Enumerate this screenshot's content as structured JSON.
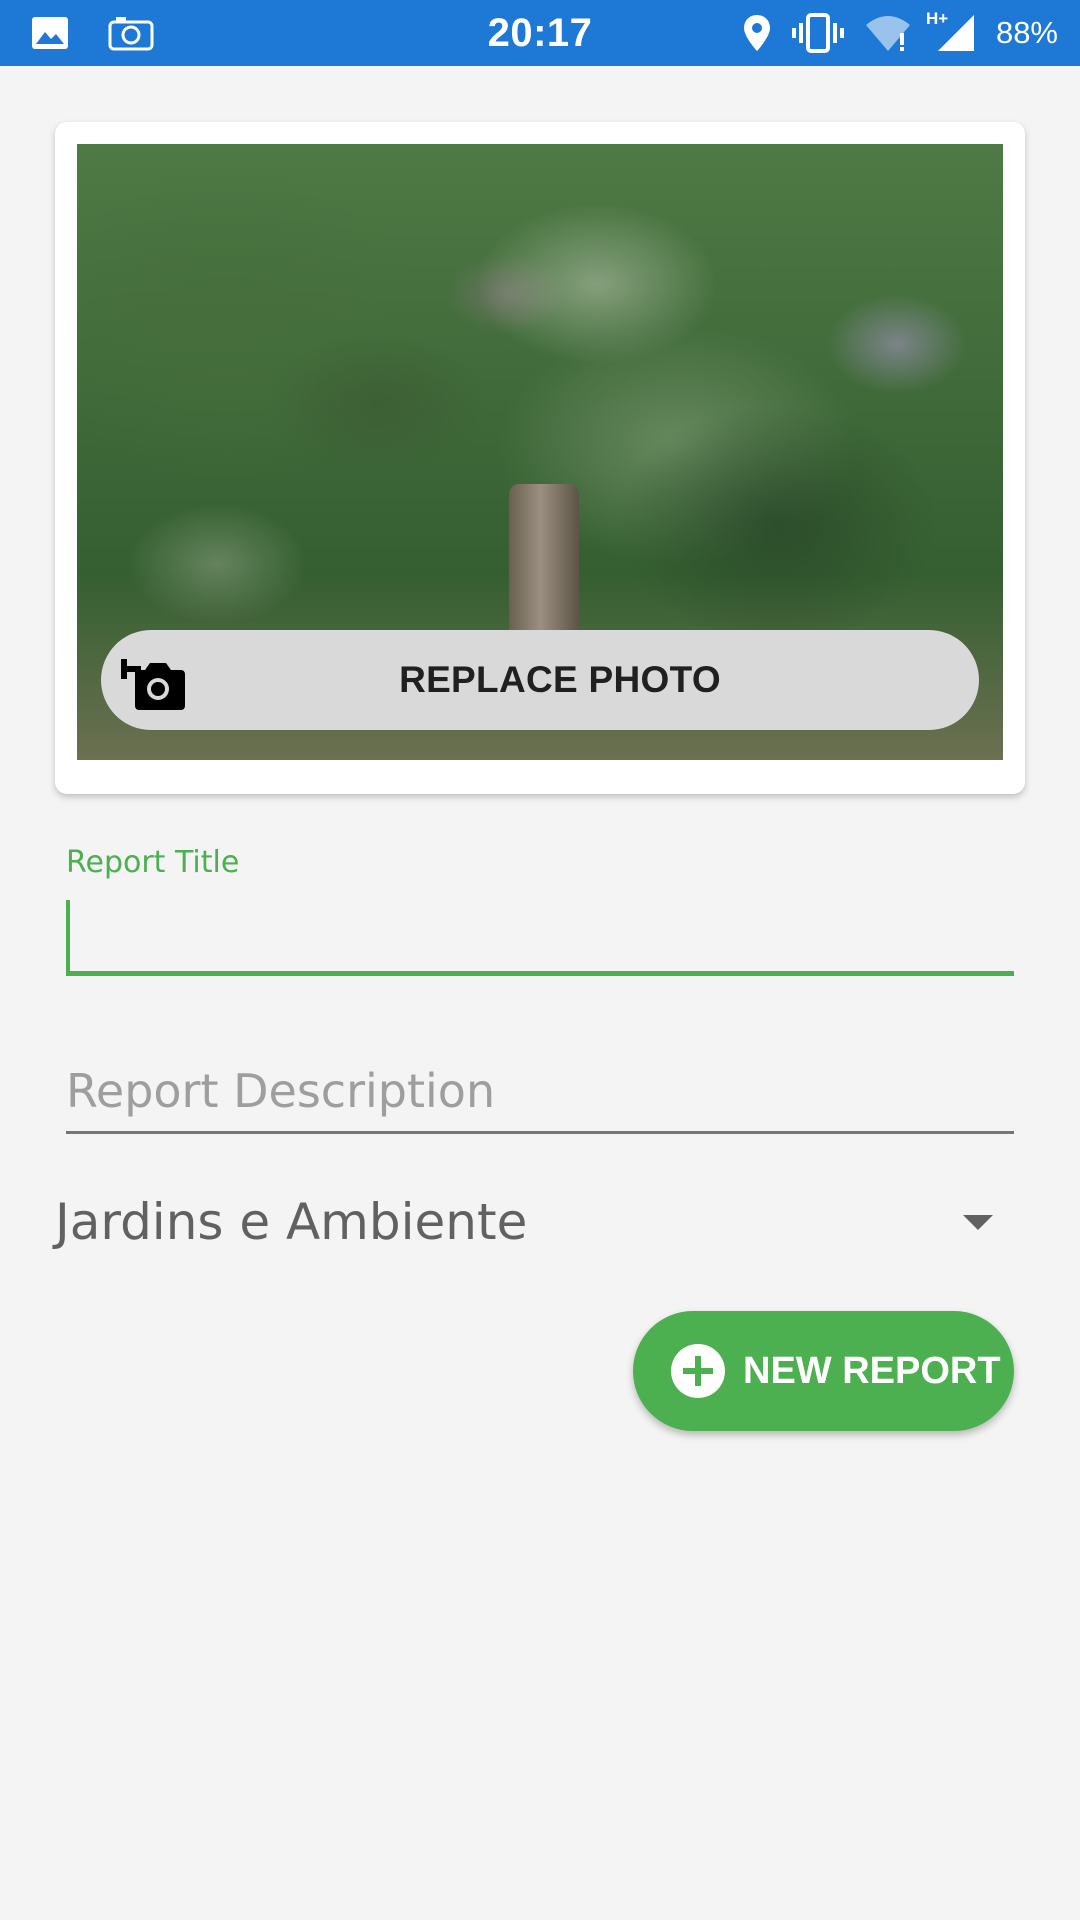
{
  "status_bar": {
    "time": "20:17",
    "battery": "88%",
    "network": "H+",
    "icons": [
      "image-icon",
      "screenshot-camera-icon",
      "location-icon",
      "vibrate-icon",
      "wifi-alert-icon",
      "cell-signal-icon"
    ]
  },
  "photo_card": {
    "replace_button_label": "REPLACE PHOTO",
    "replace_icon": "add-a-photo-icon"
  },
  "form": {
    "title_label": "Report Title",
    "title_value": "",
    "description_placeholder": "Report Description",
    "description_value": "",
    "category_selected": "Jardins e Ambiente"
  },
  "actions": {
    "new_report_label": "NEW REPORT",
    "new_report_icon": "add-circle-icon"
  },
  "colors": {
    "status_bar": "#1e78d6",
    "accent_green": "#4caf50",
    "background": "#f4f4f4",
    "replace_button_bg": "#d9d9d9"
  }
}
